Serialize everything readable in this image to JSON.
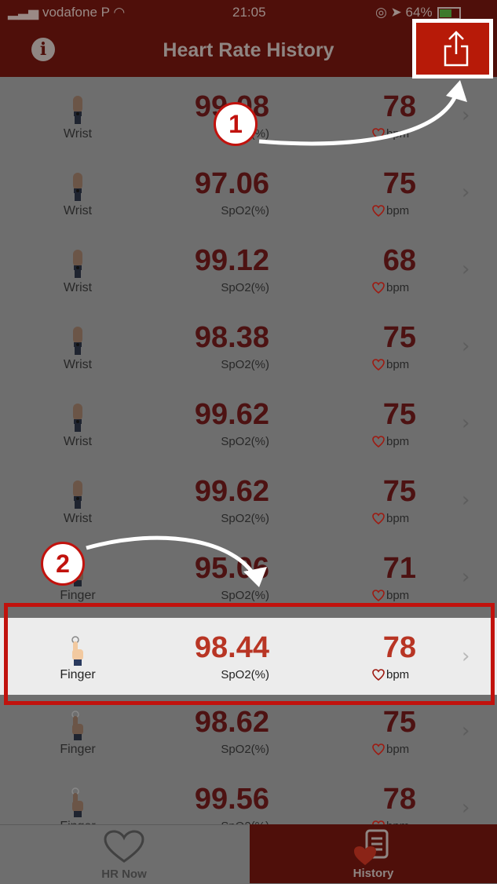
{
  "status_bar": {
    "carrier": "vodafone P",
    "time": "21:05",
    "battery": "64%"
  },
  "header": {
    "title": "Heart Rate History",
    "info_icon": "info-icon",
    "share_icon": "share-icon"
  },
  "list": {
    "spo2_label": "SpO2(%)",
    "hr_unit": "bpm",
    "rows": [
      {
        "sensor": "Wrist",
        "spo2": "99.08",
        "hr": "78"
      },
      {
        "sensor": "Wrist",
        "spo2": "97.06",
        "hr": "75"
      },
      {
        "sensor": "Wrist",
        "spo2": "99.12",
        "hr": "68"
      },
      {
        "sensor": "Wrist",
        "spo2": "98.38",
        "hr": "75"
      },
      {
        "sensor": "Wrist",
        "spo2": "99.62",
        "hr": "75"
      },
      {
        "sensor": "Wrist",
        "spo2": "99.62",
        "hr": "75"
      },
      {
        "sensor": "Finger",
        "spo2": "95.06",
        "hr": "71"
      },
      {
        "sensor": "Finger",
        "spo2": "98.44",
        "hr": "78"
      },
      {
        "sensor": "Finger",
        "spo2": "98.62",
        "hr": "75"
      },
      {
        "sensor": "Finger",
        "spo2": "99.56",
        "hr": "78"
      }
    ]
  },
  "tabs": {
    "hr_now": "HR Now",
    "history": "History"
  },
  "callouts": {
    "one": "1",
    "two": "2"
  },
  "colors": {
    "accent": "#b71a08",
    "highlight_border": "#c1120d",
    "value_red": "#b83524"
  }
}
